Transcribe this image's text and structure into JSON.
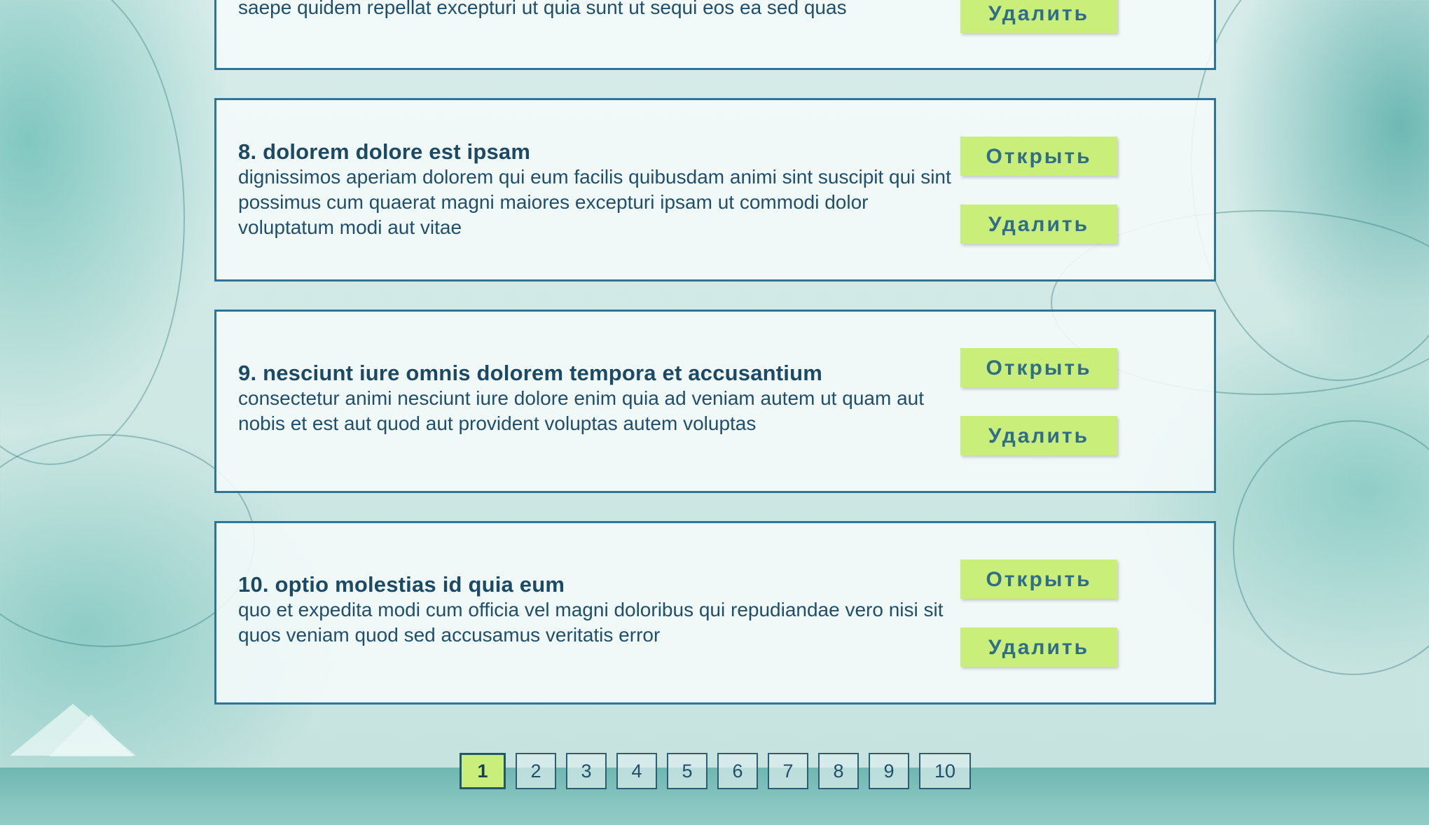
{
  "cards": [
    {
      "title": "",
      "description": "saepe quidem repellat excepturi ut quia sunt ut sequi eos ea sed quas",
      "open_label": "Открыть",
      "delete_label": "Удалить"
    },
    {
      "title": "8. dolorem dolore est ipsam",
      "description": "dignissimos aperiam dolorem qui eum facilis quibusdam animi sint suscipit qui sint possimus cum quaerat magni maiores excepturi ipsam ut commodi dolor voluptatum modi aut vitae",
      "open_label": "Открыть",
      "delete_label": "Удалить"
    },
    {
      "title": "9. nesciunt iure omnis dolorem tempora et accusantium",
      "description": "consectetur animi nesciunt iure dolore enim quia ad veniam autem ut quam aut nobis et est aut quod aut provident voluptas autem voluptas",
      "open_label": "Открыть",
      "delete_label": "Удалить"
    },
    {
      "title": "10. optio molestias id quia eum",
      "description": "quo et expedita modi cum officia vel magni doloribus qui repudiandae vero nisi sit quos veniam quod sed accusamus veritatis error",
      "open_label": "Открыть",
      "delete_label": "Удалить"
    }
  ],
  "pagination": {
    "current": "1",
    "pages": [
      "1",
      "2",
      "3",
      "4",
      "5",
      "6",
      "7",
      "8",
      "9",
      "10"
    ]
  },
  "colors": {
    "accent_button": "#c9ef7a",
    "card_border": "#2e7398",
    "text": "#1f4f6a"
  }
}
